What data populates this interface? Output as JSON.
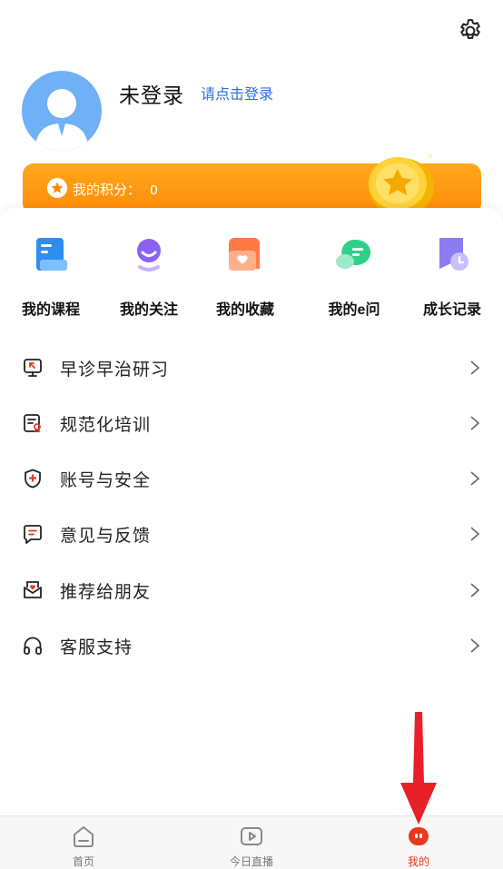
{
  "header": {
    "settings_icon": "gear-icon"
  },
  "profile": {
    "username": "未登录",
    "login_link": "请点击登录"
  },
  "points": {
    "label": "我的积分：",
    "value": "0",
    "accent": "#ff8a08"
  },
  "shortcuts": [
    {
      "label": "我的课程",
      "icon": "course-book-icon",
      "color": "#2f8cf0"
    },
    {
      "label": "我的关注",
      "icon": "follow-person-icon",
      "color": "#8b63f0"
    },
    {
      "label": "我的收藏",
      "icon": "favorite-heart-icon",
      "color": "#ff7a45"
    },
    {
      "label": "我的e问",
      "icon": "chat-bubble-icon",
      "color": "#2fd08a"
    },
    {
      "label": "成长记录",
      "icon": "growth-record-icon",
      "color": "#8c7cf2"
    }
  ],
  "menu": [
    {
      "label": "早诊早治研习",
      "icon": "monitor-icon"
    },
    {
      "label": "规范化培训",
      "icon": "certificate-icon"
    },
    {
      "label": "账号与安全",
      "icon": "shield-icon"
    },
    {
      "label": "意见与反馈",
      "icon": "feedback-icon"
    },
    {
      "label": "推荐给朋友",
      "icon": "envelope-heart-icon"
    },
    {
      "label": "客服支持",
      "icon": "headphones-icon"
    }
  ],
  "bottom_nav": [
    {
      "label": "首页",
      "icon": "home-icon",
      "active": false
    },
    {
      "label": "今日直播",
      "icon": "live-play-icon",
      "active": false
    },
    {
      "label": "我的",
      "icon": "me-face-icon",
      "active": true
    }
  ],
  "colors": {
    "active_tab": "#e8391f",
    "link": "#2f6fd8"
  }
}
